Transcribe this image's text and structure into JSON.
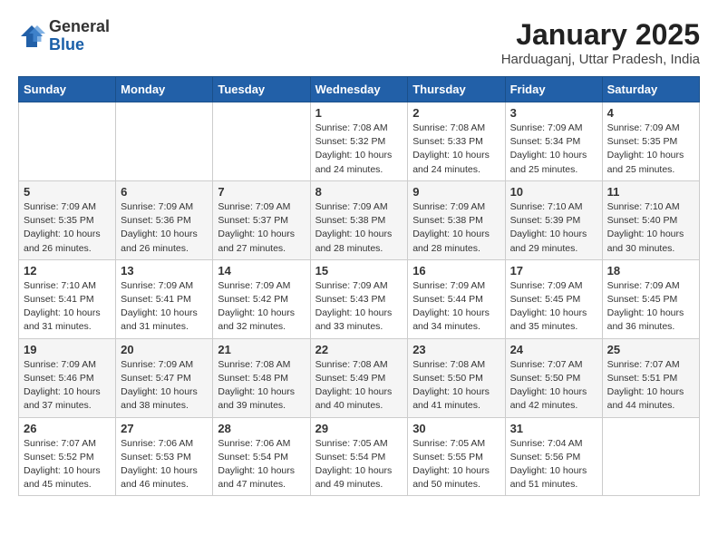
{
  "header": {
    "logo_general": "General",
    "logo_blue": "Blue",
    "month_title": "January 2025",
    "location": "Harduaganj, Uttar Pradesh, India"
  },
  "weekdays": [
    "Sunday",
    "Monday",
    "Tuesday",
    "Wednesday",
    "Thursday",
    "Friday",
    "Saturday"
  ],
  "weeks": [
    [
      {
        "day": "",
        "info": ""
      },
      {
        "day": "",
        "info": ""
      },
      {
        "day": "",
        "info": ""
      },
      {
        "day": "1",
        "info": "Sunrise: 7:08 AM\nSunset: 5:32 PM\nDaylight: 10 hours\nand 24 minutes."
      },
      {
        "day": "2",
        "info": "Sunrise: 7:08 AM\nSunset: 5:33 PM\nDaylight: 10 hours\nand 24 minutes."
      },
      {
        "day": "3",
        "info": "Sunrise: 7:09 AM\nSunset: 5:34 PM\nDaylight: 10 hours\nand 25 minutes."
      },
      {
        "day": "4",
        "info": "Sunrise: 7:09 AM\nSunset: 5:35 PM\nDaylight: 10 hours\nand 25 minutes."
      }
    ],
    [
      {
        "day": "5",
        "info": "Sunrise: 7:09 AM\nSunset: 5:35 PM\nDaylight: 10 hours\nand 26 minutes."
      },
      {
        "day": "6",
        "info": "Sunrise: 7:09 AM\nSunset: 5:36 PM\nDaylight: 10 hours\nand 26 minutes."
      },
      {
        "day": "7",
        "info": "Sunrise: 7:09 AM\nSunset: 5:37 PM\nDaylight: 10 hours\nand 27 minutes."
      },
      {
        "day": "8",
        "info": "Sunrise: 7:09 AM\nSunset: 5:38 PM\nDaylight: 10 hours\nand 28 minutes."
      },
      {
        "day": "9",
        "info": "Sunrise: 7:09 AM\nSunset: 5:38 PM\nDaylight: 10 hours\nand 28 minutes."
      },
      {
        "day": "10",
        "info": "Sunrise: 7:10 AM\nSunset: 5:39 PM\nDaylight: 10 hours\nand 29 minutes."
      },
      {
        "day": "11",
        "info": "Sunrise: 7:10 AM\nSunset: 5:40 PM\nDaylight: 10 hours\nand 30 minutes."
      }
    ],
    [
      {
        "day": "12",
        "info": "Sunrise: 7:10 AM\nSunset: 5:41 PM\nDaylight: 10 hours\nand 31 minutes."
      },
      {
        "day": "13",
        "info": "Sunrise: 7:09 AM\nSunset: 5:41 PM\nDaylight: 10 hours\nand 31 minutes."
      },
      {
        "day": "14",
        "info": "Sunrise: 7:09 AM\nSunset: 5:42 PM\nDaylight: 10 hours\nand 32 minutes."
      },
      {
        "day": "15",
        "info": "Sunrise: 7:09 AM\nSunset: 5:43 PM\nDaylight: 10 hours\nand 33 minutes."
      },
      {
        "day": "16",
        "info": "Sunrise: 7:09 AM\nSunset: 5:44 PM\nDaylight: 10 hours\nand 34 minutes."
      },
      {
        "day": "17",
        "info": "Sunrise: 7:09 AM\nSunset: 5:45 PM\nDaylight: 10 hours\nand 35 minutes."
      },
      {
        "day": "18",
        "info": "Sunrise: 7:09 AM\nSunset: 5:45 PM\nDaylight: 10 hours\nand 36 minutes."
      }
    ],
    [
      {
        "day": "19",
        "info": "Sunrise: 7:09 AM\nSunset: 5:46 PM\nDaylight: 10 hours\nand 37 minutes."
      },
      {
        "day": "20",
        "info": "Sunrise: 7:09 AM\nSunset: 5:47 PM\nDaylight: 10 hours\nand 38 minutes."
      },
      {
        "day": "21",
        "info": "Sunrise: 7:08 AM\nSunset: 5:48 PM\nDaylight: 10 hours\nand 39 minutes."
      },
      {
        "day": "22",
        "info": "Sunrise: 7:08 AM\nSunset: 5:49 PM\nDaylight: 10 hours\nand 40 minutes."
      },
      {
        "day": "23",
        "info": "Sunrise: 7:08 AM\nSunset: 5:50 PM\nDaylight: 10 hours\nand 41 minutes."
      },
      {
        "day": "24",
        "info": "Sunrise: 7:07 AM\nSunset: 5:50 PM\nDaylight: 10 hours\nand 42 minutes."
      },
      {
        "day": "25",
        "info": "Sunrise: 7:07 AM\nSunset: 5:51 PM\nDaylight: 10 hours\nand 44 minutes."
      }
    ],
    [
      {
        "day": "26",
        "info": "Sunrise: 7:07 AM\nSunset: 5:52 PM\nDaylight: 10 hours\nand 45 minutes."
      },
      {
        "day": "27",
        "info": "Sunrise: 7:06 AM\nSunset: 5:53 PM\nDaylight: 10 hours\nand 46 minutes."
      },
      {
        "day": "28",
        "info": "Sunrise: 7:06 AM\nSunset: 5:54 PM\nDaylight: 10 hours\nand 47 minutes."
      },
      {
        "day": "29",
        "info": "Sunrise: 7:05 AM\nSunset: 5:54 PM\nDaylight: 10 hours\nand 49 minutes."
      },
      {
        "day": "30",
        "info": "Sunrise: 7:05 AM\nSunset: 5:55 PM\nDaylight: 10 hours\nand 50 minutes."
      },
      {
        "day": "31",
        "info": "Sunrise: 7:04 AM\nSunset: 5:56 PM\nDaylight: 10 hours\nand 51 minutes."
      },
      {
        "day": "",
        "info": ""
      }
    ]
  ]
}
